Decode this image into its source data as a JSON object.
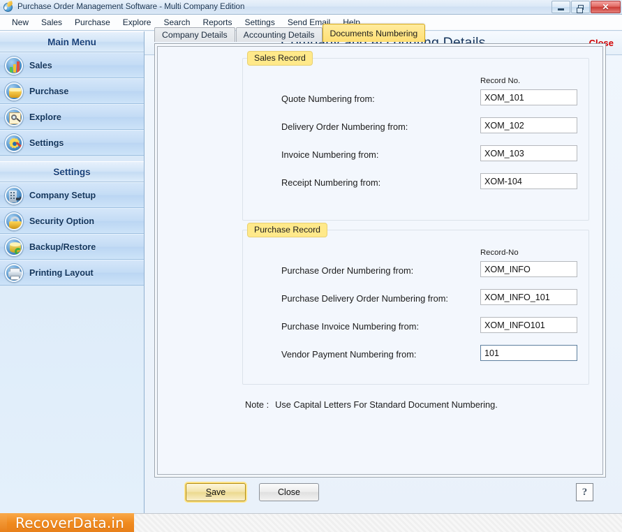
{
  "window": {
    "title": "Purchase Order Management Software - Multi Company Edition",
    "app_icon": "globe-leaf-icon",
    "minimize_label": "–",
    "maximize_label": "❐",
    "close_label": "✕"
  },
  "menubar": {
    "items": [
      {
        "label": "New",
        "name": "menu-new"
      },
      {
        "label": "Sales",
        "name": "menu-sales"
      },
      {
        "label": "Purchase",
        "name": "menu-purchase"
      },
      {
        "label": "Explore",
        "name": "menu-explore"
      },
      {
        "label": "Search",
        "name": "menu-search"
      },
      {
        "label": "Reports",
        "name": "menu-reports"
      },
      {
        "label": "Settings",
        "name": "menu-settings"
      },
      {
        "label": "Send Email",
        "name": "menu-send-email"
      },
      {
        "label": "Help",
        "name": "menu-help"
      }
    ]
  },
  "sidebar": {
    "panels": [
      {
        "header": "Main Menu",
        "items": [
          {
            "label": "Sales",
            "icon": "bar-chart-icon"
          },
          {
            "label": "Purchase",
            "icon": "basket-icon"
          },
          {
            "label": "Explore",
            "icon": "magnifier-document-icon"
          },
          {
            "label": "Settings",
            "icon": "gear-pencil-icon"
          }
        ]
      },
      {
        "header": "Settings",
        "items": [
          {
            "label": "Company Setup",
            "icon": "building-arrow-icon"
          },
          {
            "label": "Security Option",
            "icon": "padlock-icon"
          },
          {
            "label": "Backup/Restore",
            "icon": "database-refresh-icon"
          },
          {
            "label": "Printing Layout",
            "icon": "printer-icon"
          }
        ]
      }
    ]
  },
  "content": {
    "title": "Company and Accounting Details",
    "close_link": "Close",
    "tabs": [
      {
        "label": "Company Details",
        "active": false
      },
      {
        "label": "Accounting Details",
        "active": false
      },
      {
        "label": "Documents Numbering",
        "active": true
      }
    ],
    "groups": [
      {
        "title": "Sales Record",
        "column_header": "Record No.",
        "fields": [
          {
            "label": "Quote Numbering from:",
            "value": "XOM_101",
            "focused": false
          },
          {
            "label": "Delivery Order Numbering from:",
            "value": "XOM_102",
            "focused": false
          },
          {
            "label": "Invoice Numbering from:",
            "value": "XOM_103",
            "focused": false
          },
          {
            "label": "Receipt Numbering from:",
            "value": "XOM-104",
            "focused": false
          }
        ]
      },
      {
        "title": "Purchase Record",
        "column_header": "Record-No",
        "fields": [
          {
            "label": "Purchase Order Numbering from:",
            "value": "XOM_INFO",
            "focused": false
          },
          {
            "label": "Purchase Delivery Order Numbering from:",
            "value": "XOM_INFO_101",
            "focused": false
          },
          {
            "label": "Purchase Invoice Numbering from:",
            "value": "XOM_INFO101",
            "focused": false
          },
          {
            "label": "Vendor Payment Numbering from:",
            "value": "101",
            "focused": true
          }
        ]
      }
    ],
    "note_label": "Note :",
    "note_text": "Use Capital Letters For Standard Document Numbering."
  },
  "buttons": {
    "save": {
      "accel": "S",
      "rest": "ave"
    },
    "save_label": "Save",
    "close_label": "Close",
    "help_label": "?"
  },
  "watermark": {
    "text": "RecoverData.in"
  },
  "colors": {
    "accent_blue": "#16355c",
    "tab_active": "#ffdf74",
    "close_red": "#d10000",
    "watermark_orange": "#f08a1e",
    "save_highlight": "#ffe58a"
  }
}
